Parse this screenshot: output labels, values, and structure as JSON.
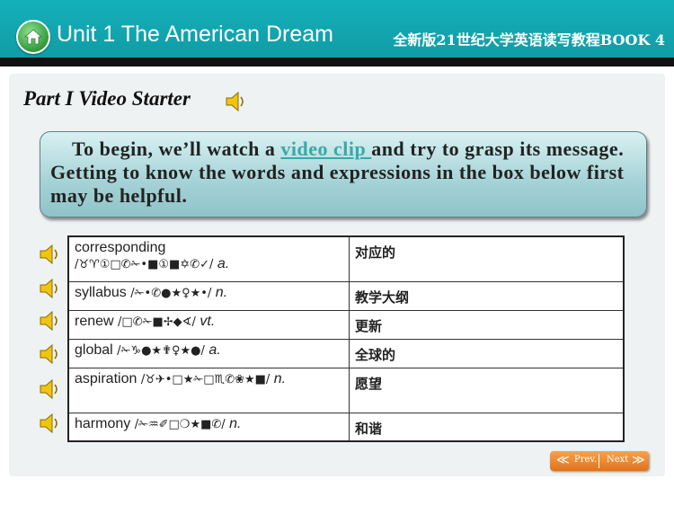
{
  "header": {
    "unit_title": "Unit 1 The American Dream",
    "book_title": "全新版21世纪大学英语读写教程BOOK 4"
  },
  "part": {
    "title": "Part I  Video Starter"
  },
  "intro": {
    "text_before": "To begin, we’ll watch a ",
    "link": "video clip ",
    "text_after": "and try to grasp its message. Getting to know the words and expressions in the box below first may be helpful."
  },
  "vocab": [
    {
      "word": "corresponding",
      "pron": "/♉♈①□✆✁•■①■✡✆✓/",
      "pos": "a.",
      "zh": "对应的"
    },
    {
      "word": "syllabus",
      "pron": "/✁•✆●★♀★•/",
      "pos": "n.",
      "zh": "教学大纲"
    },
    {
      "word": "renew",
      "pron": "/□✆✁■✢◆∢/",
      "pos": "vt.",
      "zh": "更新"
    },
    {
      "word": "global",
      "pron": "/✁♑●★✟♀★●/",
      "pos": "a.",
      "zh": "全球的"
    },
    {
      "word": "aspiration",
      "pron": "/♉✈•□★✁□♏✆❀★■/",
      "pos": "n.",
      "zh": "愿望"
    },
    {
      "word": "harmony",
      "pron": "/✁♒✐□❍★■✆/",
      "pos": "n.",
      "zh": "和谐"
    }
  ],
  "nav": {
    "prev": "Prev.",
    "next": "Next",
    "arrow_left": "≪",
    "arrow_right": "≫"
  },
  "icons": {
    "home": "home-icon",
    "speaker": "speaker-icon"
  },
  "colors": {
    "header": "#15b0ba",
    "link": "#39a9a8",
    "pager": "#e0731b"
  }
}
